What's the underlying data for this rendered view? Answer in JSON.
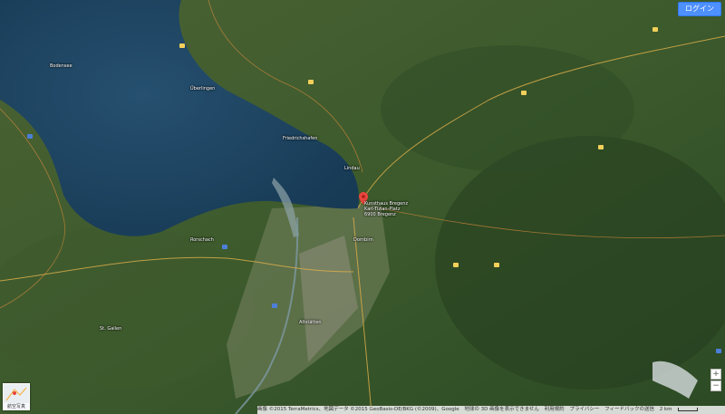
{
  "header": {
    "login_label": "ログイン"
  },
  "places": [
    {
      "id": "p1",
      "label": "Überlingen"
    },
    {
      "id": "p2",
      "label": "Friedrichshafen"
    },
    {
      "id": "p3",
      "label": "Lindau"
    },
    {
      "id": "p4",
      "label": "Rorschach"
    },
    {
      "id": "p5",
      "label": "Dornbirn"
    },
    {
      "id": "p6",
      "label": "St. Gallen"
    },
    {
      "id": "p7",
      "label": "Altstätten"
    },
    {
      "id": "p8",
      "label": "Bodensee"
    }
  ],
  "pin": {
    "label_line1": "Kunsthaus Bregenz",
    "label_line2": "Karl-Tizian-Platz",
    "label_line3": "6900 Bregenz"
  },
  "minimap": {
    "label": "航空写真"
  },
  "zoom": {
    "in_label": "+",
    "out_label": "−"
  },
  "footer": {
    "imagery": "画像 ©2015 TerraMetrics、地図データ ©2015 GeoBasis-DE/BKG (©2009)、Google",
    "no3d": "地球の 3D 画像を表示できません",
    "terms": "利用規約",
    "privacy": "プライバシー",
    "feedback": "フィードバックの送信",
    "scale": "2 km"
  },
  "colors": {
    "water": "#1f4766",
    "forest": "#2f4c24",
    "field": "#556b3a",
    "urban": "#8a8a7a",
    "road": "#e2b04a"
  }
}
